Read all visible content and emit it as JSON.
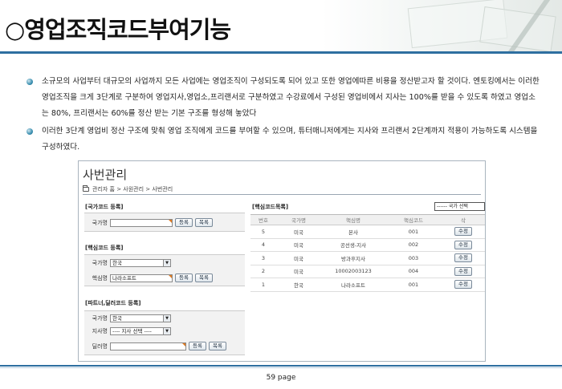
{
  "slide": {
    "title": "○영업조직코드부여기능",
    "bullets": [
      "소규모의 사업부터 대규모의 사업까지 모든 사업에는 영업조직이 구성되도록 되어 있고 또한 영업에따른 비용을 정산받고자 할 것이다. 엔토킹에서는 이러한 영업조직을 크게 3단계로 구분하여 영업지사,영업소,프리랜서로 구분하였고 수강료에서 구성된 영업비에서 지사는 100%를 받을 수 있도록 하였고 영업소는 80%, 프리랜서는 60%를 정산 받는 기본 구조를 형성해 놓았다",
      "이러한 3단계 영업비 정산 구조에 맞춰 영업 조직에게 코드를 부여할 수 있으며, 튜터매니저에게는 지사와 프리랜서 2단계까지 적용이 가능하도록 시스템을 구성하였다."
    ],
    "page_label": "59 page"
  },
  "screenshot": {
    "page_title": "사번관리",
    "breadcrumb": "관리자 홈 > 사원관리 > 사번관리",
    "country_section": {
      "title": "[국가코드 등록]",
      "country_label": "국가명",
      "country_value": "",
      "register_btn": "등록",
      "list_btn": "목록"
    },
    "core_section": {
      "title": "[핵심코드 등록]",
      "country_label": "국가명",
      "country_value": "한국",
      "core_label": "핵심명",
      "core_value": "나라소프트",
      "register_btn": "등록",
      "list_btn": "목록"
    },
    "partner_section": {
      "title": "[파트너,딜러코드 등록]",
      "country_label": "국가명",
      "country_value": "한국",
      "branch_label": "지사명",
      "branch_value": "---- 지사 선택 ----",
      "dealer_label": "딜러명",
      "dealer_value": "",
      "register_btn": "등록",
      "list_btn": "목록"
    },
    "list": {
      "title": "[핵심코드목록]",
      "country_filter": "------ 국가 선택",
      "columns": [
        "번호",
        "국가명",
        "핵심명",
        "핵심코드",
        "삭"
      ],
      "rows": [
        {
          "no": "5",
          "country": "미국",
          "core": "본사",
          "code": "001",
          "action": "수정"
        },
        {
          "no": "4",
          "country": "미국",
          "core": "공선생-지사",
          "code": "002",
          "action": "수정"
        },
        {
          "no": "3",
          "country": "미국",
          "core": "방과후지사",
          "code": "003",
          "action": "수정"
        },
        {
          "no": "2",
          "country": "미국",
          "core": "10002003123",
          "code": "004",
          "action": "수정"
        },
        {
          "no": "1",
          "country": "한국",
          "core": "나라소프트",
          "code": "001",
          "action": "수정"
        }
      ]
    }
  },
  "colors": {
    "accent_rule": "#2e6fa0",
    "bullet": "#3a8fb0",
    "required_marker": "#e07a20"
  }
}
